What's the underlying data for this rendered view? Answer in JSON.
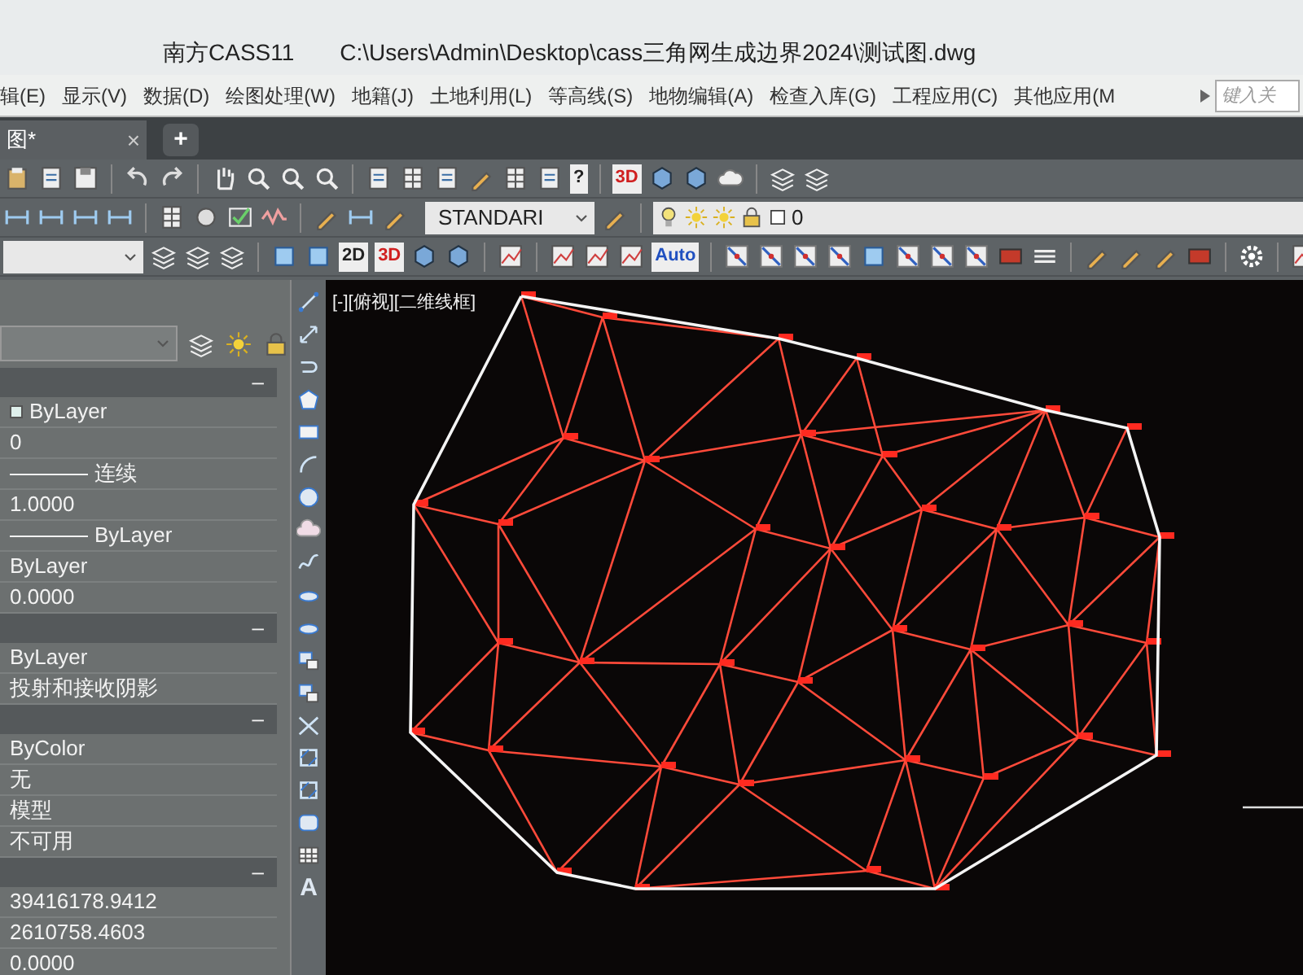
{
  "window": {
    "app": "南方CASS11",
    "path": "C:\\Users\\Admin\\Desktop\\cass三角网生成边界2024\\测试图.dwg"
  },
  "menu": [
    "辑(E)",
    "显示(V)",
    "数据(D)",
    "绘图处理(W)",
    "地籍(J)",
    "土地利用(L)",
    "等高线(S)",
    "地物编辑(A)",
    "检查入库(G)",
    "工程应用(C)",
    "其他应用(M"
  ],
  "search": {
    "placeholder": "键入关"
  },
  "tabs": [
    {
      "label": "图*",
      "selected": true,
      "close": "×"
    }
  ],
  "new_tab": "+",
  "toolbar": {
    "help": "?",
    "badge_3d": "3D",
    "text_style": "STANDARI",
    "layer": "0",
    "view_2d": "2D",
    "view_3d": "3D",
    "auto": "Auto"
  },
  "properties": [
    {
      "toggle": "–",
      "rows": [
        {
          "kind": "swatch",
          "value": "ByLayer"
        },
        {
          "kind": "text",
          "value": "0"
        },
        {
          "kind": "line",
          "value": "连续"
        },
        {
          "kind": "text",
          "value": "1.0000"
        },
        {
          "kind": "line",
          "value": "ByLayer"
        },
        {
          "kind": "text",
          "value": "ByLayer"
        },
        {
          "kind": "text",
          "value": "0.0000"
        }
      ]
    },
    {
      "toggle": "–",
      "rows": [
        {
          "kind": "text",
          "value": "ByLayer"
        },
        {
          "kind": "text",
          "value": "投射和接收阴影"
        }
      ]
    },
    {
      "toggle": "–",
      "rows": [
        {
          "kind": "text",
          "value": "ByColor"
        },
        {
          "kind": "text",
          "value": "无"
        },
        {
          "kind": "text",
          "value": "模型"
        },
        {
          "kind": "text",
          "value": "不可用"
        }
      ]
    },
    {
      "toggle": "–",
      "rows": [
        {
          "kind": "text",
          "value": "39416178.9412"
        },
        {
          "kind": "text",
          "value": "2610758.4603"
        },
        {
          "kind": "text",
          "value": "0.0000"
        }
      ]
    }
  ],
  "draw_tools": {
    "text_tool": "A"
  },
  "viewport": {
    "label": "[-][俯视][二维线框]"
  }
}
